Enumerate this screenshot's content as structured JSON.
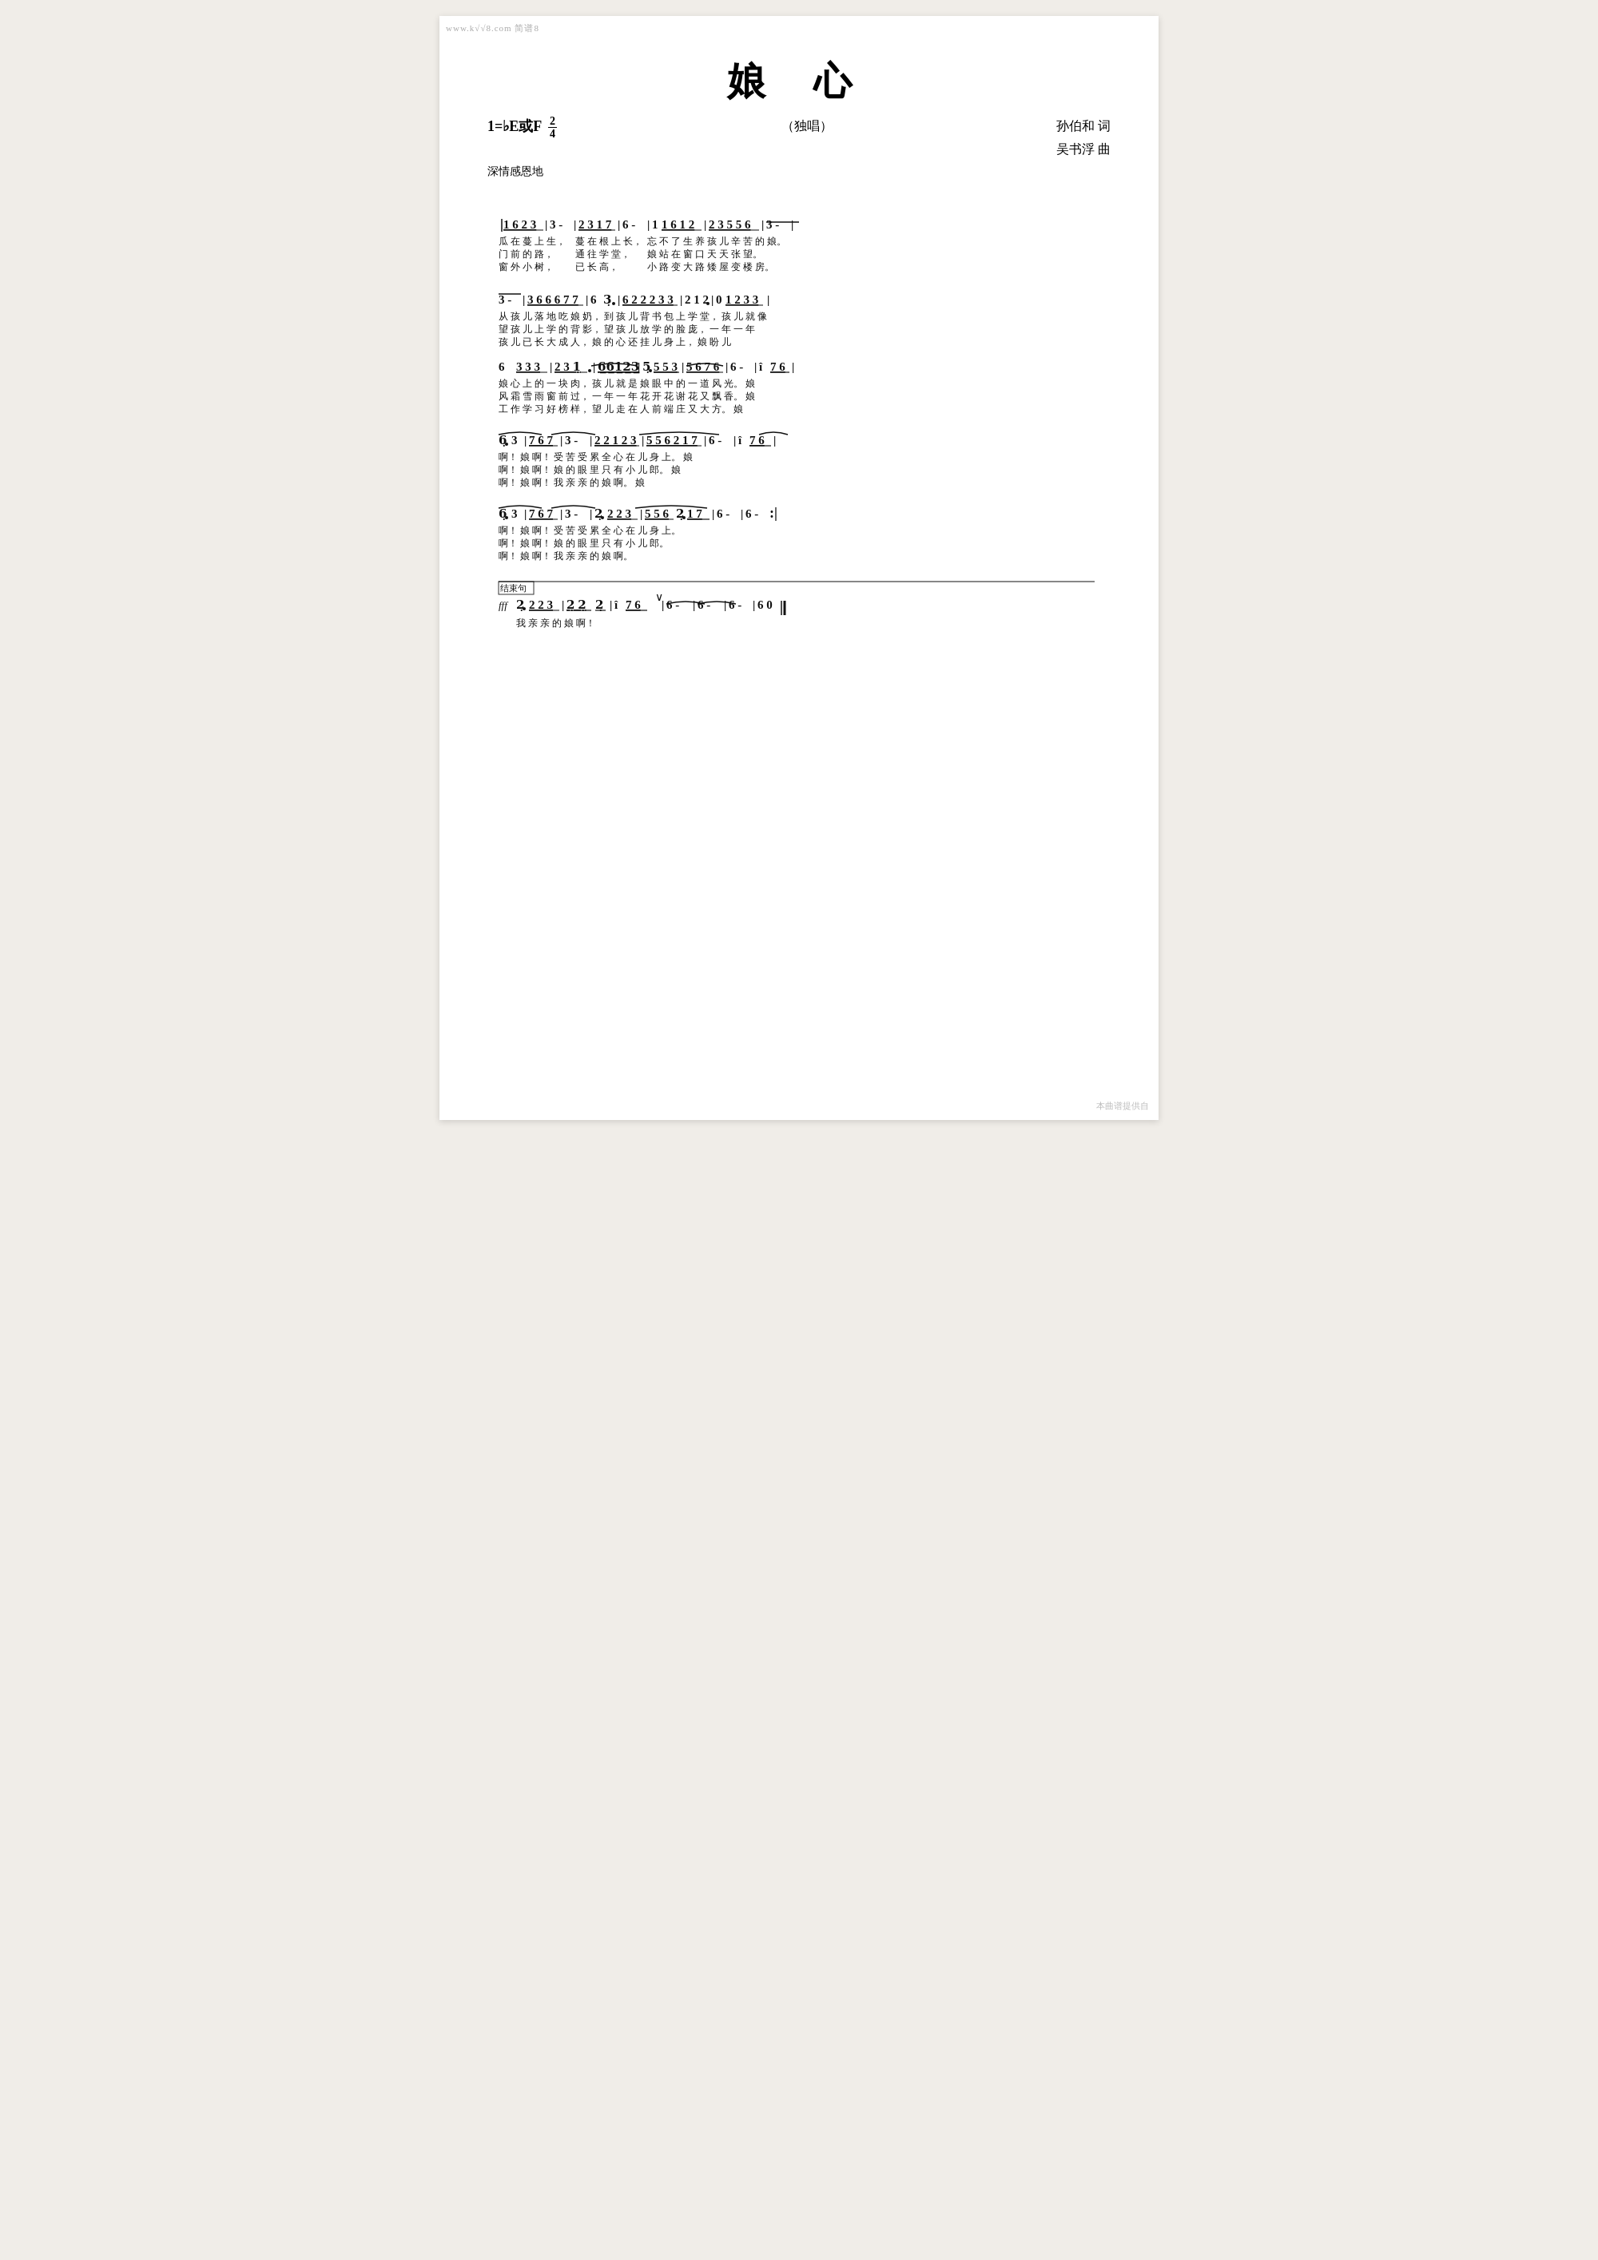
{
  "page": {
    "watermark_top": "www.k√√8.com 简谱8",
    "watermark_bottom": "本曲谱提供自",
    "title": "娘  心",
    "subtitle": "（独唱）",
    "key": "1=♭E或F",
    "time_sig": "2/4",
    "tempo": "深情感恩地",
    "author_lyric": "孙伯和 词",
    "author_music": "吴书浮 曲",
    "sections": [
      {
        "id": "section1",
        "notation": "1̲ 6̲ 2̲ 3̲ | 3 -  | 2̲ 3̲ 1̲ 7̲ | 6 -  | 1 1̲ 6̲ 1̲ 2̲ | 2̲ 3̲ 5̲ 5̲ 6̲ | 3 -  |",
        "lyrics": [
          "瓜 在 蔓 上  生，       蔓 在 根 上  长，         忘 不 了 生 养  孩 儿 辛 苦 的  娘。",
          "门  前 的  路，         通 往 学   堂，         娘 站 在 窗 口  天 天 张    望。",
          "窗 外 小   树，         已  长  高，         小 路 变 大 路  矮 屋 变 楼    房。"
        ]
      },
      {
        "id": "section2",
        "notation": "3̄ -  | 3̲ 6̲ 6̲ 6̲ 7̲ 7̲ | 6 3̣ · | 6̲ 2̲ 2̲ 2̲ 3̲ 3̲ | 2 1 2 · | 0 1̲ 2̲ 3̲ 3̲ |",
        "lyrics": [
          "    从 孩 儿 落 地 吃  娘 奶，   到 孩 儿 背 书 包 上 学 堂，      孩 儿 就 像",
          "    望 孩 儿 上 学 的  背 影，   望 孩 儿 放 学 的  脸  庞，      一 年 一 年",
          "    孩 儿 已 长 大    成 人，   娘 的 心 还 挂   儿 身 上，      娘 盼 儿"
        ]
      },
      {
        "id": "section3",
        "notation": "6   3̲ 3̲ 3̲ | 2̲ 3̲ 1̣ · | 6̲ 6̲ 1̲ 2̲ 3̲ | 5̣ · 5̲ 5̲ 3̲ | 5̲ 6̲ 7̲ 6̲ | 6 -  | i 7̲ 6̲ |",
        "lyrics": [
          "娘  心 上 的  一 块 肉，  孩 儿  就 是 娘  眼 中 的  一 道 风  光。    娘",
          "风 霜 雪 雨  窗 前 过，  一 年  一 年 花  开 花 谢  花 又 飘  香。    娘",
          "工 作 学 习    好 榜 样， 望 儿  走 在 人   前 端 庄  又    大   方。    娘"
        ]
      },
      {
        "id": "section4",
        "notation": "6̣ · 3 | 7̲ 6̲ 7̲ | 3 -  | 2̲ 2̲ 1̲ 2̲ 3̲ | 5̲ 5̲ 6̲ 2̲ 1̲ 7̲ | 6 -  | i 7̲ 6̲ |",
        "lyrics": [
          "啊！     娘     啊！     受 苦 受    累 全 心 在 儿 身  上。    娘",
          "啊！     娘     啊！     娘 的 眼 里  只 有  小  儿   郎。    娘",
          "啊！     娘     啊！     我          亲 亲 的 娘     啊。    娘"
        ]
      },
      {
        "id": "section5",
        "notation": "6̣ · 3 | 7̲ 6̲ 7̲ | 3 -  | 2̣ · 2̲ 2̲ 3̲ | 5̲ 5̲ 6̲ 2̣ · 1̲ 7̲ | 6 -  | 6 -  :|",
        "lyrics": [
          "啊！     娘     啊！     受 苦 受 累  全 心 在 儿 身   上。",
          "啊！     娘     啊！     娘 的 眼 里   只 有  小  儿    郎。",
          "啊！     娘     啊！     我            亲 亲 的 娘     啊。"
        ]
      },
      {
        "id": "section6",
        "label": "结束句",
        "notation": "2̣ · 2̲ 2̲ 3̲ | 2̲ 2̲  2̲ | i  7̲ 6̲ | 6 -  | 6 -  | 6 -  | 6  0 ‖",
        "lyrics": [
          "我      亲 亲    的  娘     啊！"
        ]
      }
    ]
  }
}
